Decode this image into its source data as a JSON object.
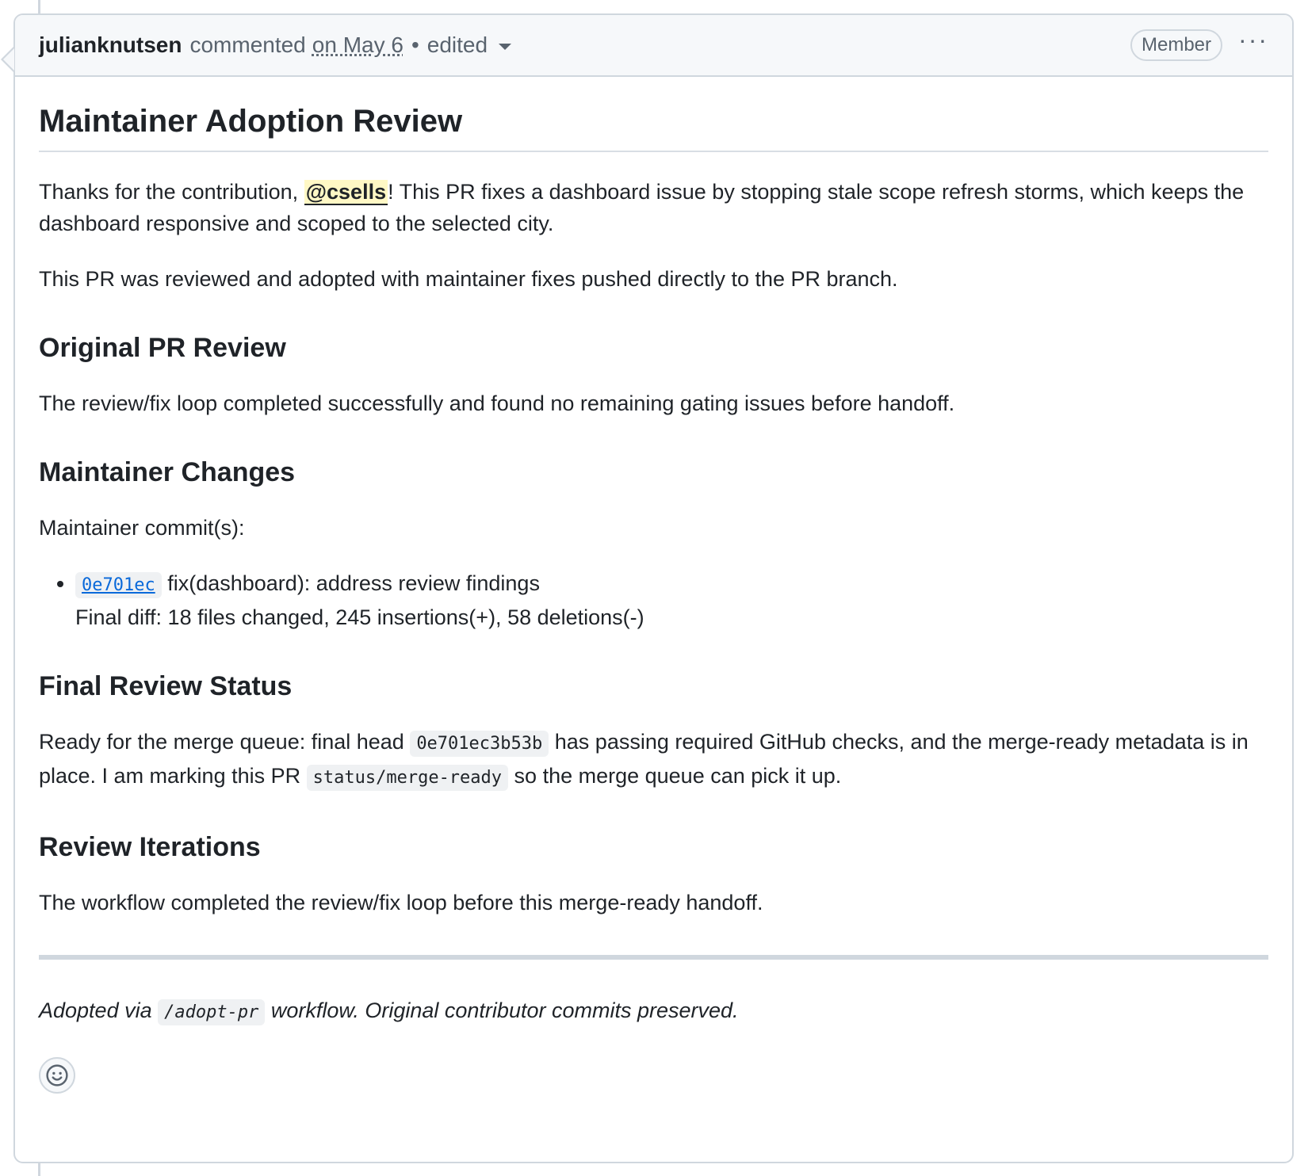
{
  "comment": {
    "author": "julianknutsen",
    "action": "commented",
    "date": "on May 6",
    "separator": "•",
    "edited": "edited",
    "badge": "Member",
    "menu_icon": "kebab-horizontal-icon"
  },
  "body": {
    "title": "Maintainer Adoption Review",
    "intro": {
      "before": "Thanks for the contribution, ",
      "mention": "@csells",
      "after": "! This PR fixes a dashboard issue by stopping stale scope refresh storms, which keeps the dashboard responsive and scoped to the selected city."
    },
    "adopted": "This PR was reviewed and adopted with maintainer fixes pushed directly to the PR branch.",
    "sections": {
      "original_review": {
        "heading": "Original PR Review",
        "text": "The review/fix loop completed successfully and found no remaining gating issues before handoff."
      },
      "maintainer_changes": {
        "heading": "Maintainer Changes",
        "commits_label": "Maintainer commit(s):",
        "commit_sha": "0e701ec",
        "commit_message": " fix(dashboard): address review findings",
        "final_diff": "Final diff: 18 files changed, 245 insertions(+), 58 deletions(-)"
      },
      "final_status": {
        "heading": "Final Review Status",
        "text_1": "Ready for the merge queue: final head ",
        "head_sha": "0e701ec3b53b",
        "text_2": " has passing required GitHub checks, and the merge-ready metadata is in place. I am marking this PR ",
        "label": "status/merge-ready",
        "text_3": " so the merge queue can pick it up."
      },
      "iterations": {
        "heading": "Review Iterations",
        "text": "The workflow completed the review/fix loop before this merge-ready handoff."
      }
    },
    "footer": {
      "text_1": "Adopted via ",
      "command": "/adopt-pr",
      "text_2": " workflow. Original contributor commits preserved."
    }
  },
  "reactions": {
    "icon": "smiley-icon"
  }
}
